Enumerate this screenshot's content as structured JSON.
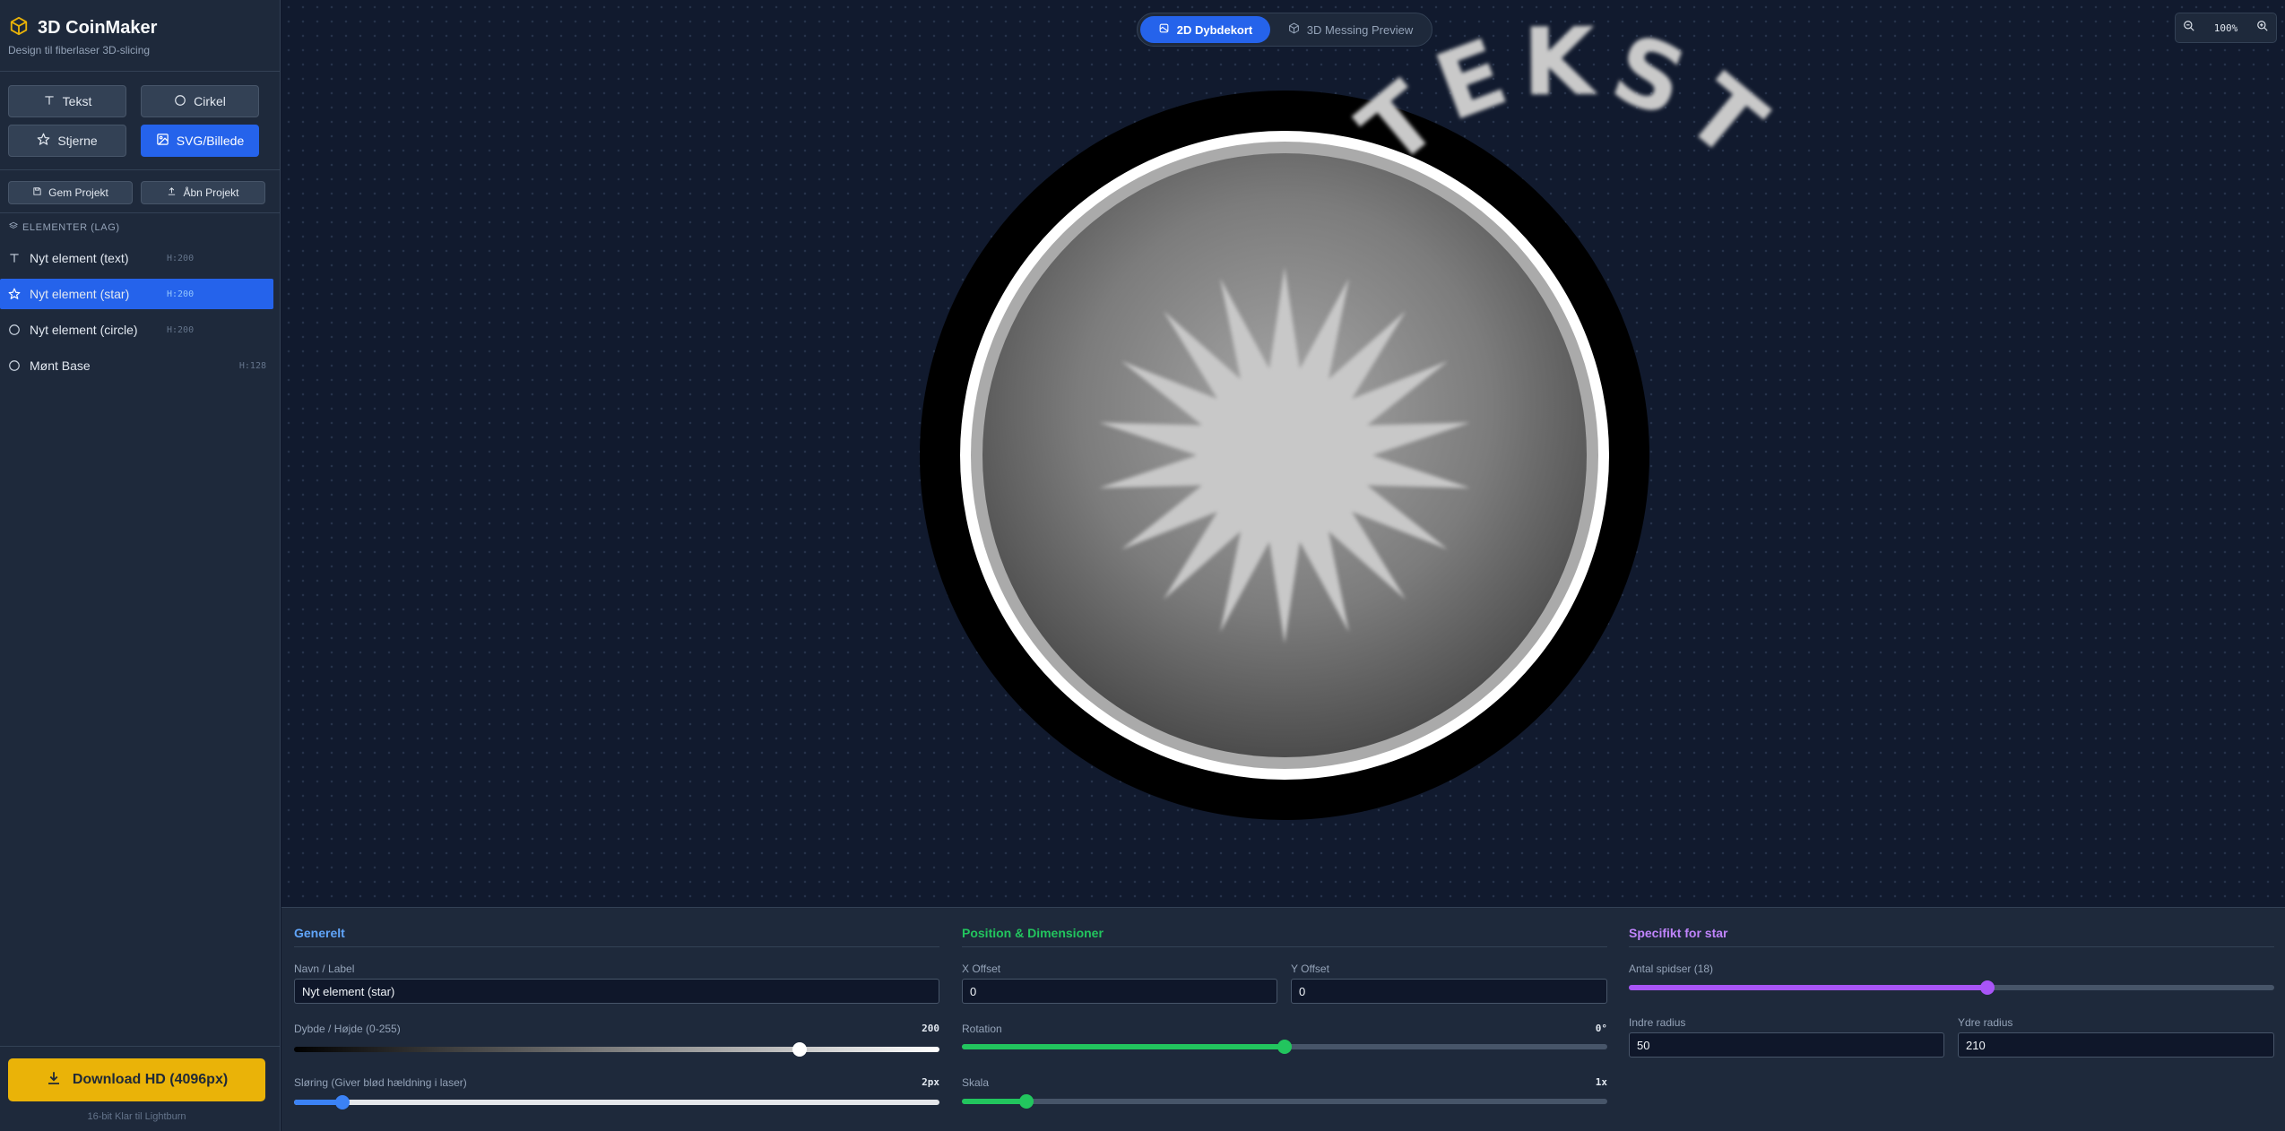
{
  "app": {
    "title": "3D CoinMaker",
    "subtitle": "Design til fiberlaser 3D-slicing"
  },
  "tools": {
    "text": "Tekst",
    "circle": "Cirkel",
    "star": "Stjerne",
    "svg": "SVG/Billede"
  },
  "project": {
    "save": "Gem Projekt",
    "open": "Åbn Projekt"
  },
  "layers": {
    "title": "ELEMENTER (LAG)",
    "items": [
      {
        "name": "Nyt element (text)",
        "height": "H:200"
      },
      {
        "name": "Nyt element (star)",
        "height": "H:200"
      },
      {
        "name": "Nyt element (circle)",
        "height": "H:200"
      },
      {
        "name": "Mønt Base",
        "height": "H:128"
      }
    ]
  },
  "download": {
    "label": "Download HD (4096px)",
    "note": "16-bit Klar til Lightburn"
  },
  "view": {
    "depth_map": "2D Dybdekort",
    "preview_3d": "3D Messing Preview",
    "zoom": "100%"
  },
  "coin": {
    "text": "TEKST",
    "star_points": 18
  },
  "props": {
    "general": {
      "title": "Generelt",
      "name_label": "Navn / Label",
      "name_value": "Nyt element (star)",
      "depth_label": "Dybde / Højde (0-255)",
      "depth_value": "200",
      "depth_fraction": 0.784,
      "blur_label": "Sløring (Giver blød hældning i laser)",
      "blur_value": "2px",
      "blur_fraction": 0.075
    },
    "position": {
      "title": "Position & Dimensioner",
      "x_label": "X Offset",
      "x_value": "0",
      "y_label": "Y Offset",
      "y_value": "0",
      "rotation_label": "Rotation",
      "rotation_value": "0°",
      "rotation_fraction": 0.5,
      "scale_label": "Skala",
      "scale_value": "1x",
      "scale_fraction": 0.1
    },
    "specific": {
      "title": "Specifikt for star",
      "points_label": "Antal spidser (18)",
      "points_fraction": 0.555,
      "inner_label": "Indre radius",
      "inner_value": "50",
      "outer_label": "Ydre radius",
      "outer_value": "210"
    }
  },
  "colors": {
    "accent_blue": "#2563eb",
    "accent_green": "#22c55e",
    "accent_purple": "#a855f7",
    "download_yellow": "#eab308"
  }
}
